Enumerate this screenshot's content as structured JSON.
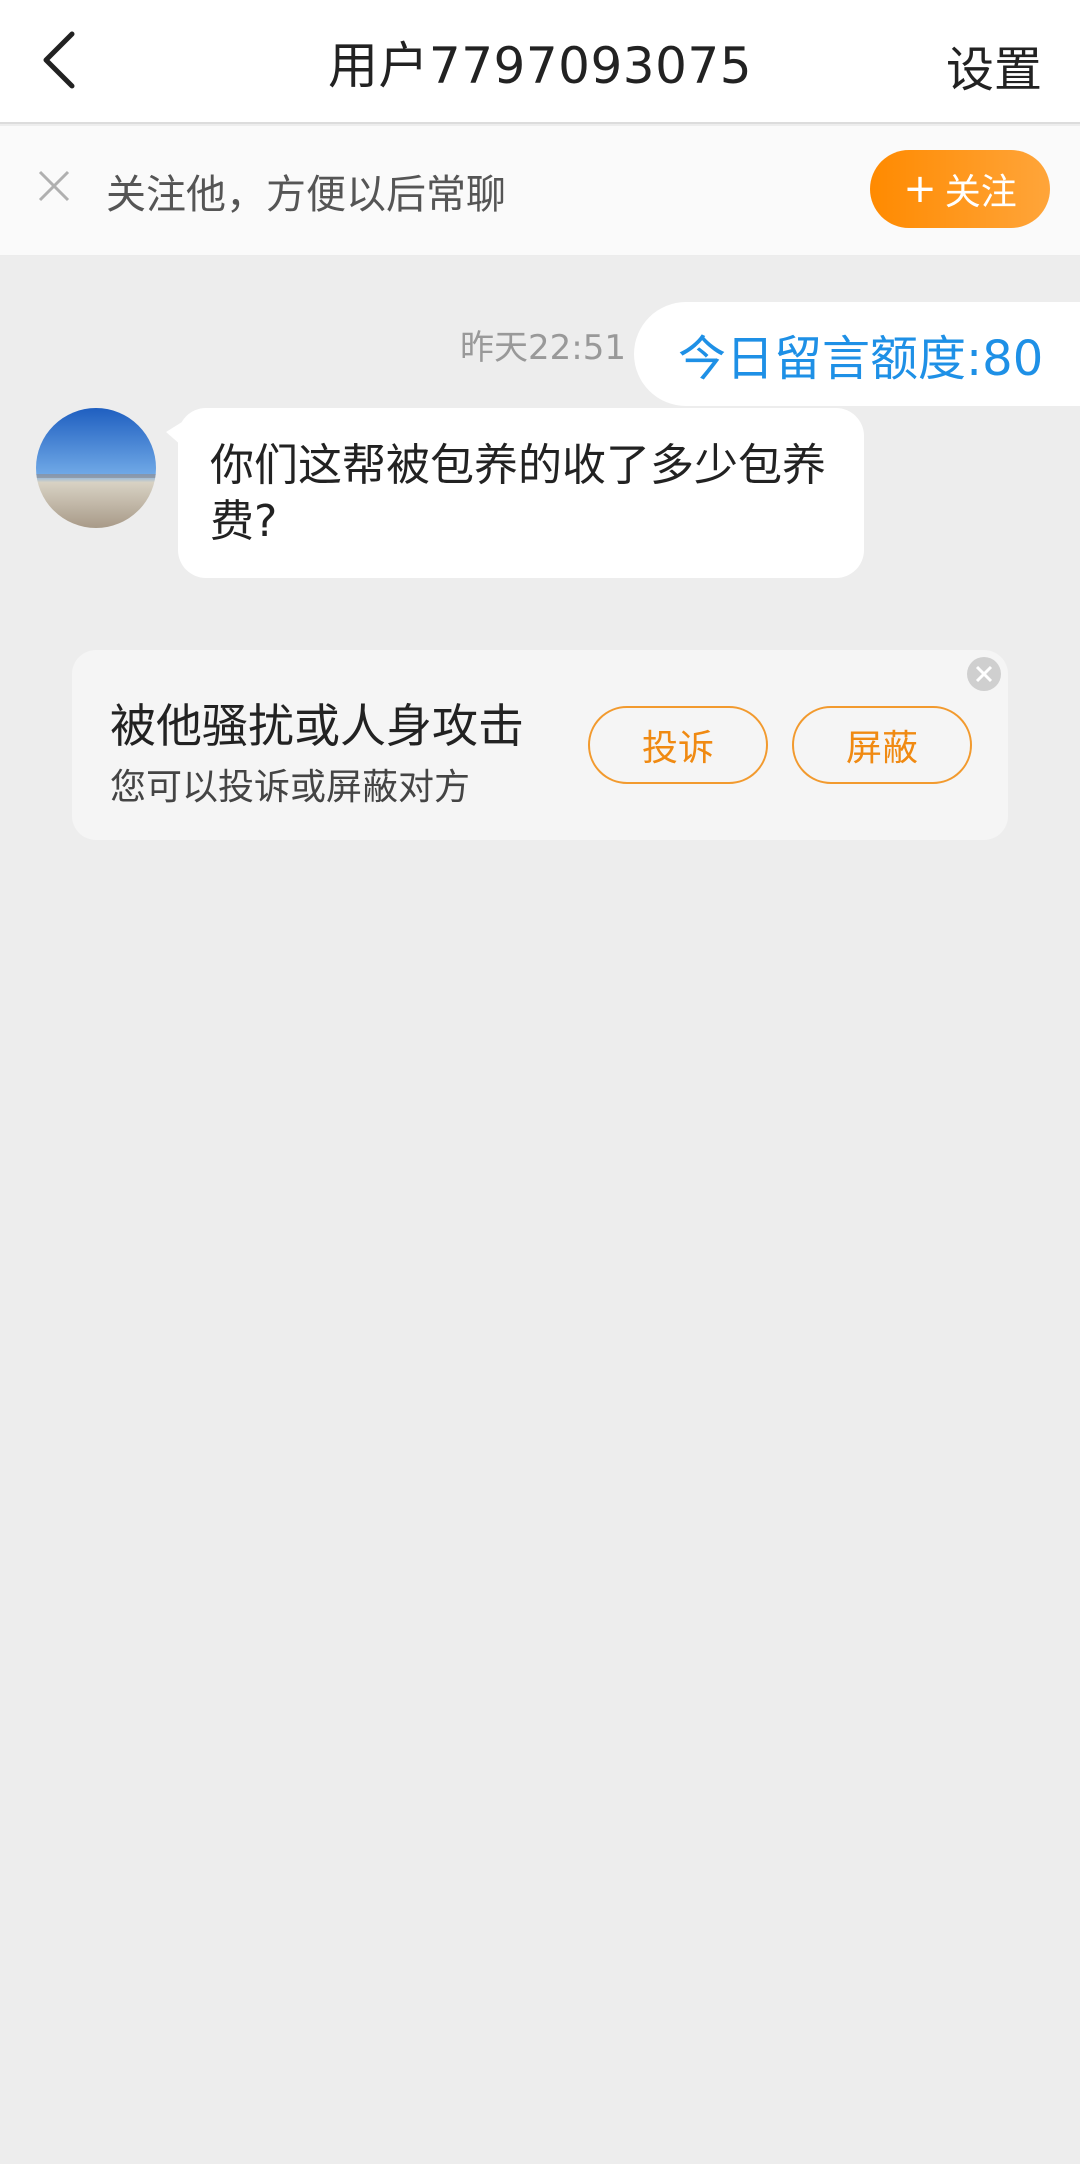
{
  "header": {
    "title": "用户7797093075",
    "settings_label": "设置"
  },
  "follow_bar": {
    "prompt": "关注他，方便以后常聊",
    "follow_label": "关注"
  },
  "chat": {
    "timestamp": "昨天22:51",
    "quota_text": "今日留言额度:80",
    "message": "你们这帮被包养的收了多少包养费?"
  },
  "report_card": {
    "title": "被他骚扰或人身攻击",
    "subtitle": "您可以投诉或屏蔽对方",
    "complain_label": "投诉",
    "block_label": "屏蔽"
  },
  "colors": {
    "accent_orange": "#ff8a00",
    "quota_blue": "#1e90e6",
    "background": "#ededed"
  },
  "icons": {
    "back": "chevron-left-icon",
    "follow_close": "close-icon",
    "card_close": "close-circle-icon",
    "avatar": "avatar-image"
  }
}
